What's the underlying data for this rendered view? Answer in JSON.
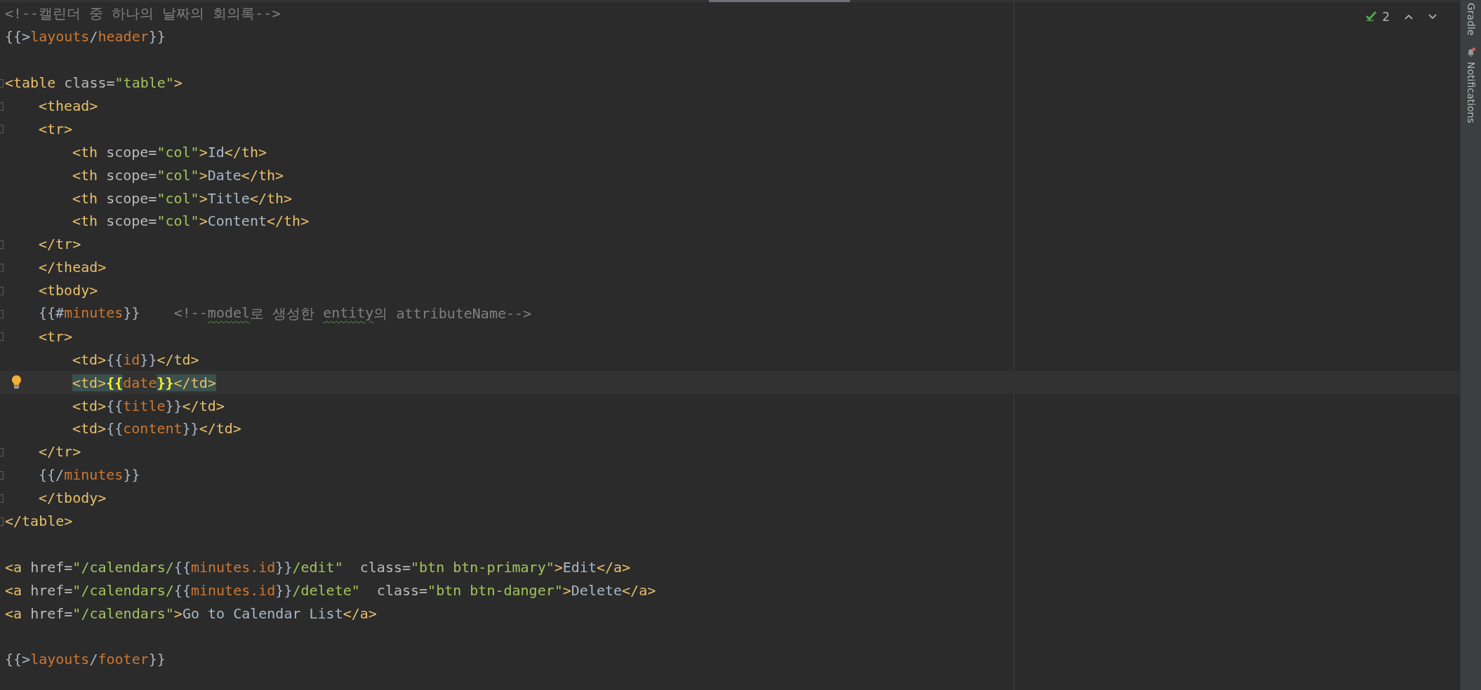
{
  "editor": {
    "lines": [
      {
        "fold": false,
        "current": false,
        "tokens": [
          {
            "text": "<!--캘린더 중 하나의 날짜의 회의록-->",
            "kind": "comment"
          }
        ]
      },
      {
        "fold": false,
        "current": false,
        "tokens": [
          {
            "text": "{{>",
            "kind": "brace"
          },
          {
            "text": "layouts",
            "kind": "var"
          },
          {
            "text": "/",
            "kind": "brace"
          },
          {
            "text": "header",
            "kind": "var"
          },
          {
            "text": "}}",
            "kind": "brace"
          }
        ]
      },
      {
        "fold": false,
        "current": false
      },
      {
        "fold": true,
        "current": false,
        "tokens": [
          {
            "text": "<table",
            "kind": "tag"
          },
          {
            "text": " class=",
            "kind": "attr"
          },
          {
            "text": "\"table\"",
            "kind": "string"
          },
          {
            "text": ">",
            "kind": "tag"
          }
        ],
        "children": [
          {
            "fold": true,
            "current": false,
            "tokens": [
              {
                "text": "<thead>",
                "kind": "tag"
              }
            ]
          },
          {
            "fold": true,
            "current": false,
            "tokens": [
              {
                "text": "<tr>",
                "kind": "tag"
              }
            ],
            "children": [
              {
                "fold": false,
                "current": false,
                "tokens": [
                  {
                    "text": "<th",
                    "kind": "tag"
                  },
                  {
                    "text": " scope=",
                    "kind": "attr"
                  },
                  {
                    "text": "\"col\"",
                    "kind": "string"
                  },
                  {
                    "text": ">",
                    "kind": "tag"
                  },
                  {
                    "text": "Id",
                    "kind": "text"
                  },
                  {
                    "text": "</th>",
                    "kind": "tag"
                  }
                ]
              },
              {
                "fold": false,
                "current": false,
                "tokens": [
                  {
                    "text": "<th",
                    "kind": "tag"
                  },
                  {
                    "text": " scope=",
                    "kind": "attr"
                  },
                  {
                    "text": "\"col\"",
                    "kind": "string"
                  },
                  {
                    "text": ">",
                    "kind": "tag"
                  },
                  {
                    "text": "Date",
                    "kind": "text"
                  },
                  {
                    "text": "</th>",
                    "kind": "tag"
                  }
                ]
              },
              {
                "fold": false,
                "current": false,
                "tokens": [
                  {
                    "text": "<th",
                    "kind": "tag"
                  },
                  {
                    "text": " scope=",
                    "kind": "attr"
                  },
                  {
                    "text": "\"col\"",
                    "kind": "string"
                  },
                  {
                    "text": ">",
                    "kind": "tag"
                  },
                  {
                    "text": "Title",
                    "kind": "text"
                  },
                  {
                    "text": "</th>",
                    "kind": "tag"
                  }
                ]
              },
              {
                "fold": false,
                "current": false,
                "tokens": [
                  {
                    "text": "<th",
                    "kind": "tag"
                  },
                  {
                    "text": " scope=",
                    "kind": "attr"
                  },
                  {
                    "text": "\"col\"",
                    "kind": "string"
                  },
                  {
                    "text": ">",
                    "kind": "tag"
                  },
                  {
                    "text": "Content",
                    "kind": "text"
                  },
                  {
                    "text": "</th>",
                    "kind": "tag"
                  }
                ]
              }
            ]
          },
          {
            "fold": true,
            "current": false,
            "tokens": [
              {
                "text": "</tr>",
                "kind": "tag"
              }
            ]
          },
          {
            "fold": true,
            "current": false,
            "tokens": [
              {
                "text": "</thead>",
                "kind": "tag"
              }
            ]
          },
          {
            "fold": true,
            "current": false,
            "tokens": [
              {
                "text": "<tbody>",
                "kind": "tag"
              }
            ]
          },
          {
            "fold": true,
            "current": false,
            "tokens": [
              {
                "text": "{{#",
                "kind": "brace"
              },
              {
                "text": "minutes",
                "kind": "var"
              },
              {
                "text": "}}",
                "kind": "brace"
              },
              {
                "text": "    <!--",
                "kind": "comment"
              },
              {
                "text": "model",
                "kind": "typo"
              },
              {
                "text": "로 생성한 ",
                "kind": "comment"
              },
              {
                "text": "entity",
                "kind": "typo"
              },
              {
                "text": "의 attributeName-->",
                "kind": "comment"
              }
            ]
          },
          {
            "fold": true,
            "current": false,
            "tokens": [
              {
                "text": "<tr>",
                "kind": "tag"
              }
            ],
            "children": [
              {
                "fold": false,
                "current": false,
                "tokens": [
                  {
                    "text": "<td>",
                    "kind": "tag"
                  },
                  {
                    "text": "{{",
                    "kind": "brace"
                  },
                  {
                    "text": "id",
                    "kind": "var"
                  },
                  {
                    "text": "}}",
                    "kind": "brace"
                  },
                  {
                    "text": "</td>",
                    "kind": "tag"
                  }
                ]
              },
              {
                "fold": false,
                "current": true,
                "tokens": [
                  {
                    "text": "<td>",
                    "kind": "tag-match"
                  },
                  {
                    "text": "{{",
                    "kind": "brace-match"
                  },
                  {
                    "text": "date",
                    "kind": "var"
                  },
                  {
                    "text": "}}",
                    "kind": "brace-match"
                  },
                  {
                    "text": "</td>",
                    "kind": "tag-match"
                  }
                ]
              },
              {
                "fold": false,
                "current": false,
                "tokens": [
                  {
                    "text": "<td>",
                    "kind": "tag"
                  },
                  {
                    "text": "{{",
                    "kind": "brace"
                  },
                  {
                    "text": "title",
                    "kind": "var"
                  },
                  {
                    "text": "}}",
                    "kind": "brace"
                  },
                  {
                    "text": "</td>",
                    "kind": "tag"
                  }
                ]
              },
              {
                "fold": false,
                "current": false,
                "tokens": [
                  {
                    "text": "<td>",
                    "kind": "tag"
                  },
                  {
                    "text": "{{",
                    "kind": "brace"
                  },
                  {
                    "text": "content",
                    "kind": "var"
                  },
                  {
                    "text": "}}",
                    "kind": "brace"
                  },
                  {
                    "text": "</td>",
                    "kind": "tag"
                  }
                ]
              }
            ]
          },
          {
            "fold": true,
            "current": false,
            "tokens": [
              {
                "text": "</tr>",
                "kind": "tag"
              }
            ]
          },
          {
            "fold": true,
            "current": false,
            "tokens": [
              {
                "text": "{{/",
                "kind": "brace"
              },
              {
                "text": "minutes",
                "kind": "var"
              },
              {
                "text": "}}",
                "kind": "brace"
              }
            ]
          },
          {
            "fold": true,
            "current": false,
            "tokens": [
              {
                "text": "</tbody>",
                "kind": "tag"
              }
            ]
          }
        ]
      },
      {
        "fold": true,
        "current": false,
        "tokens": [
          {
            "text": "</table>",
            "kind": "tag"
          }
        ]
      },
      {
        "fold": false,
        "current": false
      },
      {
        "fold": false,
        "current": false,
        "tokens": [
          {
            "text": "<a",
            "kind": "tag"
          },
          {
            "text": " href=",
            "kind": "attr"
          },
          {
            "text": "\"/calendars/",
            "kind": "string"
          },
          {
            "text": "{{",
            "kind": "brace"
          },
          {
            "text": "minutes.id",
            "kind": "var"
          },
          {
            "text": "}}",
            "kind": "brace"
          },
          {
            "text": "/edit\"",
            "kind": "string"
          },
          {
            "text": "  class=",
            "kind": "attr"
          },
          {
            "text": "\"btn btn-primary\"",
            "kind": "string"
          },
          {
            "text": ">",
            "kind": "tag"
          },
          {
            "text": "Edit",
            "kind": "text"
          },
          {
            "text": "</a>",
            "kind": "tag"
          }
        ]
      },
      {
        "fold": false,
        "current": false,
        "tokens": [
          {
            "text": "<a",
            "kind": "tag"
          },
          {
            "text": " href=",
            "kind": "attr"
          },
          {
            "text": "\"/calendars/",
            "kind": "string"
          },
          {
            "text": "{{",
            "kind": "brace"
          },
          {
            "text": "minutes.id",
            "kind": "var"
          },
          {
            "text": "}}",
            "kind": "brace"
          },
          {
            "text": "/delete\"",
            "kind": "string"
          },
          {
            "text": "  class=",
            "kind": "attr"
          },
          {
            "text": "\"btn btn-danger\"",
            "kind": "string"
          },
          {
            "text": ">",
            "kind": "tag"
          },
          {
            "text": "Delete",
            "kind": "text"
          },
          {
            "text": "</a>",
            "kind": "tag"
          }
        ]
      },
      {
        "fold": false,
        "current": false,
        "tokens": [
          {
            "text": "<a",
            "kind": "tag"
          },
          {
            "text": " href=",
            "kind": "attr"
          },
          {
            "text": "\"/calendars\"",
            "kind": "string"
          },
          {
            "text": ">",
            "kind": "tag"
          },
          {
            "text": "Go to Calendar List",
            "kind": "text"
          },
          {
            "text": "</a>",
            "kind": "tag"
          }
        ]
      },
      {
        "fold": false,
        "current": false
      },
      {
        "fold": false,
        "current": false,
        "tokens": [
          {
            "text": "{{>",
            "kind": "brace"
          },
          {
            "text": "layouts",
            "kind": "var"
          },
          {
            "text": "/",
            "kind": "brace"
          },
          {
            "text": "footer",
            "kind": "var"
          },
          {
            "text": "}}",
            "kind": "brace"
          }
        ]
      }
    ],
    "inspections": {
      "count": "2"
    }
  },
  "side_tools": [
    {
      "label": "Gradle",
      "kind": "plain",
      "unread": false
    },
    {
      "label": "Notifications",
      "kind": "bell",
      "unread": true
    }
  ]
}
